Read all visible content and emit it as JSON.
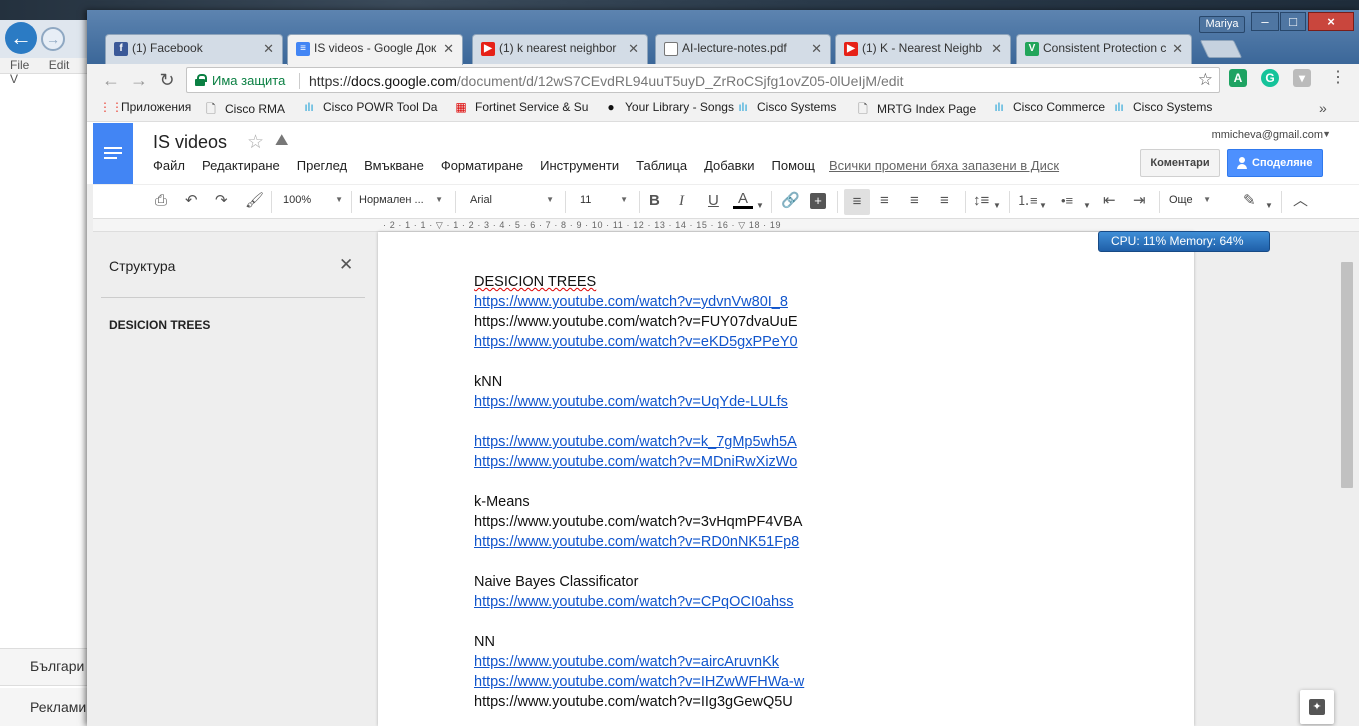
{
  "background_window": {
    "menu": [
      "File",
      "Edit",
      "V"
    ],
    "language_text": "Българи",
    "ads_text": "Реклами"
  },
  "window": {
    "user_name": "Mariya",
    "controls": {
      "minimize": "–",
      "maximize": "□",
      "close": "×"
    }
  },
  "tabs": [
    {
      "label": "(1) Facebook",
      "icon": "facebook-icon",
      "icon_glyph": "f",
      "color": "#3b5998"
    },
    {
      "label": "IS videos - Google Док",
      "icon": "google-docs-icon",
      "icon_glyph": "≡",
      "color": "#4285f4"
    },
    {
      "label": "(1) k nearest neighbor",
      "icon": "youtube-icon",
      "icon_glyph": "▶",
      "color": "#e62117"
    },
    {
      "label": "AI-lecture-notes.pdf",
      "icon": "document-icon",
      "icon_glyph": "",
      "color": "#ffffff"
    },
    {
      "label": "(1) K - Nearest Neighb",
      "icon": "youtube-icon",
      "icon_glyph": "▶",
      "color": "#e62117"
    },
    {
      "label": "Consistent Protection c",
      "icon": "v-icon",
      "icon_glyph": "V",
      "color": "#22a55a"
    }
  ],
  "address_bar": {
    "secure_label": "Има защита",
    "url_scheme": "https://",
    "url_host": "docs.google.com",
    "url_path": "/document/d/12wS7CEvdRL94uuT5uyD_ZrRoCSjfg1ovZ05-0lUeIjM/edit"
  },
  "bookmarks": [
    {
      "label": "Приложения",
      "icon": "apps-grid-icon"
    },
    {
      "label": "Cisco RMA",
      "icon": "page-icon"
    },
    {
      "label": "Cisco POWR Tool Da",
      "icon": "cisco-icon"
    },
    {
      "label": "Fortinet Service & Su",
      "icon": "fortinet-icon"
    },
    {
      "label": "Your Library - Songs",
      "icon": "spotify-icon"
    },
    {
      "label": "Cisco Systems",
      "icon": "cisco-icon"
    },
    {
      "label": "MRTG Index Page",
      "icon": "page-icon"
    },
    {
      "label": "Cisco Commerce",
      "icon": "cisco-icon"
    },
    {
      "label": "Cisco Systems",
      "icon": "cisco-icon"
    }
  ],
  "docs": {
    "title": "IS videos",
    "menu": [
      "Файл",
      "Редактиране",
      "Преглед",
      "Вмъкване",
      "Форматиране",
      "Инструменти",
      "Таблица",
      "Добавки",
      "Помощ"
    ],
    "saved_status": "Всички промени бяха запазени в Диск",
    "account": "mmicheva@gmail.com",
    "comments_button": "Коментари",
    "share_button": "Споделяне",
    "toolbar": {
      "zoom": "100%",
      "style": "Нормален ...",
      "font": "Arial",
      "size": "11",
      "more": "Още"
    },
    "ruler": "· 2 · 1 · 1 · ▽ · 1 · 2 · 3 · 4 · 5 · 6 · 7 · 8 · 9 · 10 · 11 · 12 · 13 · 14 · 15 · 16 · ▽ 18 · 19",
    "outline": {
      "title": "Структура",
      "items": [
        "DESICION TREES"
      ]
    }
  },
  "document_lines": [
    {
      "text": "DESICION TREES",
      "type": "heading"
    },
    {
      "text": "https://www.youtube.com/watch?v=ydvnVw80I_8",
      "type": "link"
    },
    {
      "text": "https://www.youtube.com/watch?v=FUY07dvaUuE",
      "type": "text"
    },
    {
      "text": "https://www.youtube.com/watch?v=eKD5gxPPeY0",
      "type": "link"
    },
    {
      "text": "",
      "type": "blank"
    },
    {
      "text": "kNN",
      "type": "text"
    },
    {
      "text": "https://www.youtube.com/watch?v=UqYde-LULfs",
      "type": "link"
    },
    {
      "text": "",
      "type": "blank"
    },
    {
      "text": "https://www.youtube.com/watch?v=k_7gMp5wh5A",
      "type": "link"
    },
    {
      "text": "https://www.youtube.com/watch?v=MDniRwXizWo",
      "type": "link"
    },
    {
      "text": "",
      "type": "blank"
    },
    {
      "text": "k-Means",
      "type": "text"
    },
    {
      "text": "https://www.youtube.com/watch?v=3vHqmPF4VBA",
      "type": "text"
    },
    {
      "text": "https://www.youtube.com/watch?v=RD0nNK51Fp8",
      "type": "link"
    },
    {
      "text": "",
      "type": "blank"
    },
    {
      "text": "Naive Bayes Classificator",
      "type": "text"
    },
    {
      "text": "https://www.youtube.com/watch?v=CPqOCI0ahss",
      "type": "link"
    },
    {
      "text": "",
      "type": "blank"
    },
    {
      "text": "NN",
      "type": "text"
    },
    {
      "text": "https://www.youtube.com/watch?v=aircAruvnKk",
      "type": "link"
    },
    {
      "text": "https://www.youtube.com/watch?v=IHZwWFHWa-w",
      "type": "link"
    },
    {
      "text": "https://www.youtube.com/watch?v=IIg3gGewQ5U",
      "type": "text"
    }
  ],
  "system_monitor": "CPU: 11%  Memory: 64%",
  "colors": {
    "docs_blue": "#4285f4",
    "link": "#1155cc",
    "share": "#4d90fe",
    "secure": "#0b8043"
  }
}
